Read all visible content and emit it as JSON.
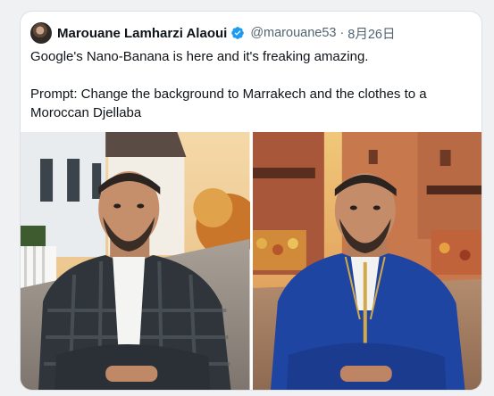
{
  "tweet": {
    "author_name": "Marouane Lamharzi Alaoui",
    "author_handle": "@marouane53",
    "separator": "·",
    "date": "8月26日",
    "text_line1": "Google's Nano-Banana is here and it's freaking amazing.",
    "text_line2": "Prompt: Change the background to Marrakech and the clothes to a Moroccan Djellaba",
    "verified_icon": "verified-badge-icon",
    "accent_color": "#1d9bf0"
  },
  "media": {
    "images": [
      {
        "name": "original-photo"
      },
      {
        "name": "edited-photo"
      }
    ]
  }
}
